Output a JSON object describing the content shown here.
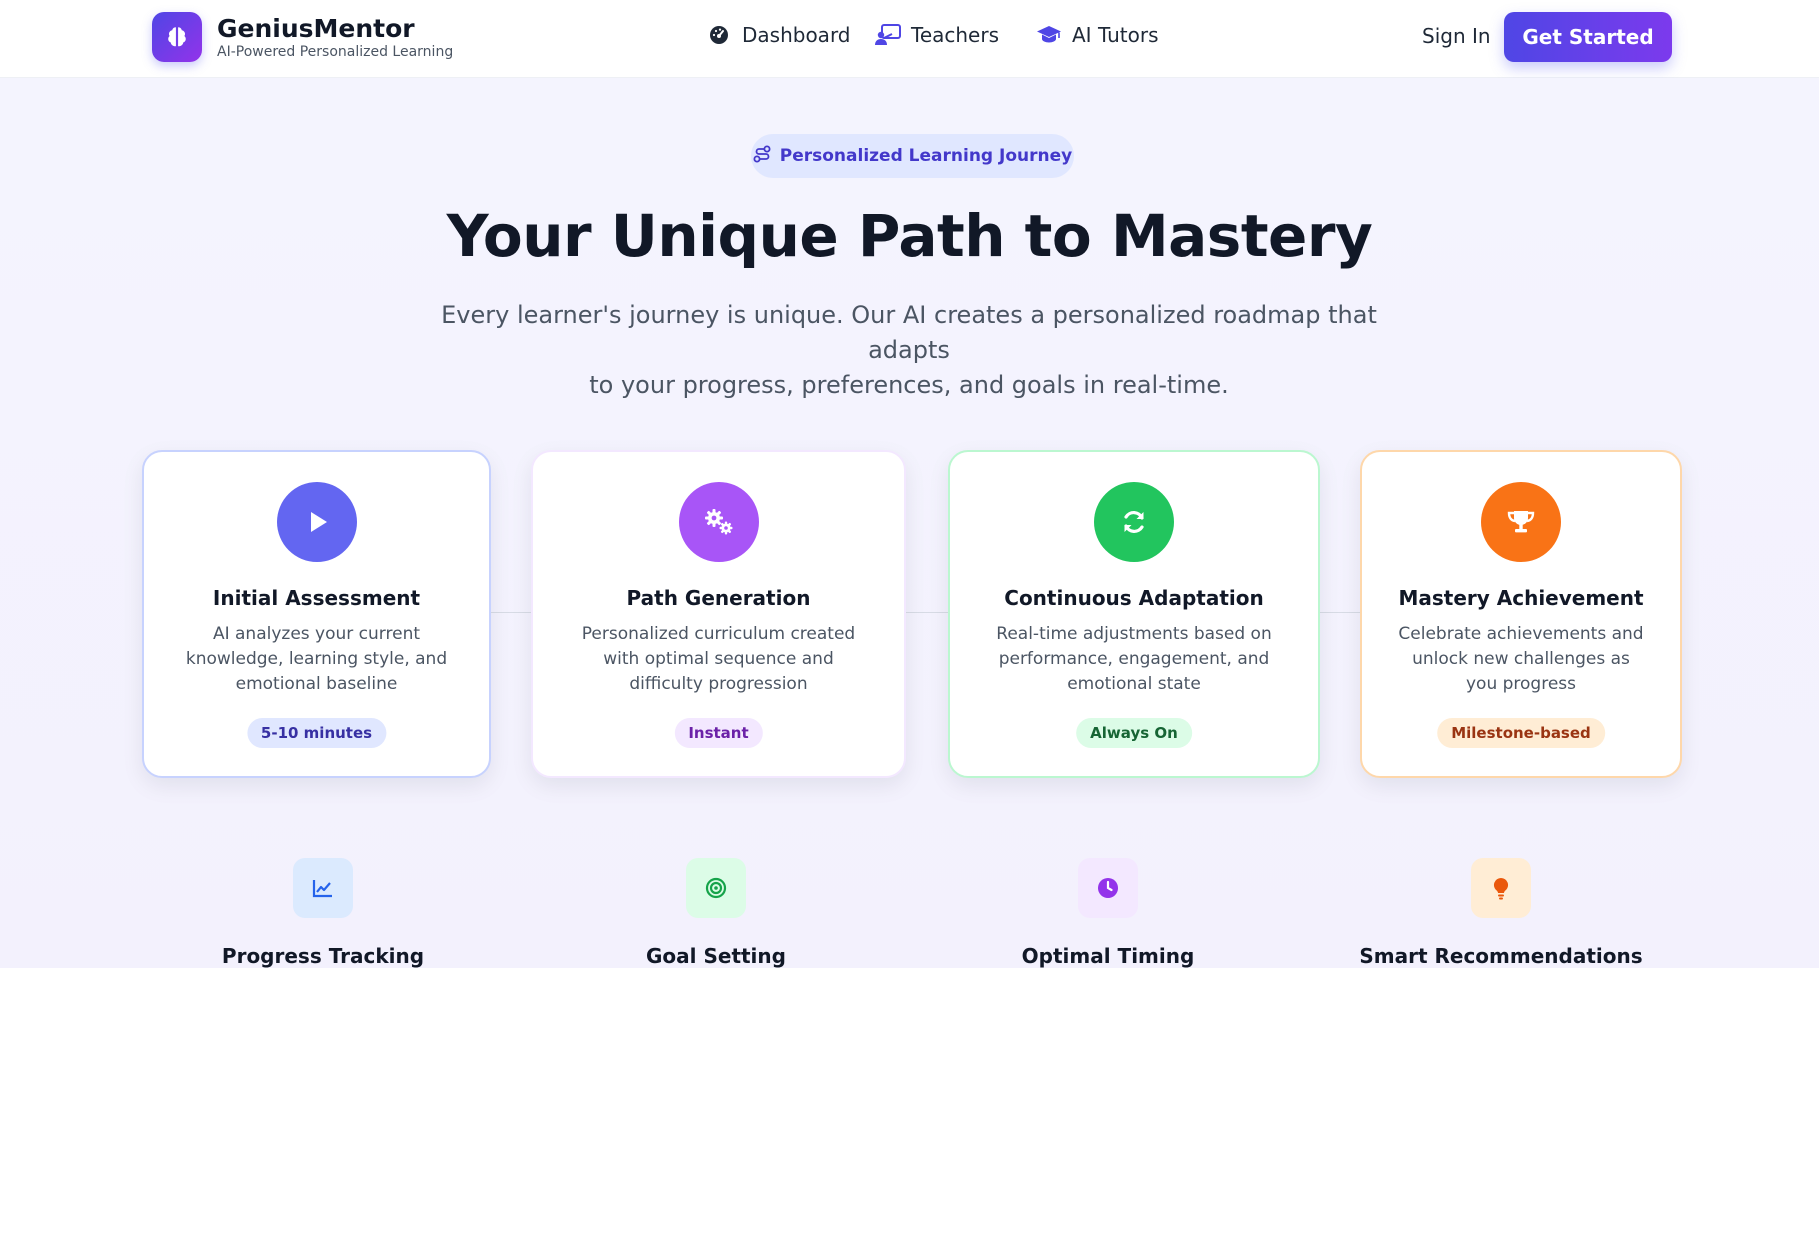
{
  "header": {
    "brand_name": "GeniusMentor",
    "brand_tagline": "AI-Powered Personalized Learning",
    "nav": [
      {
        "label": "Dashboard",
        "icon": "dashboard-gauge-icon"
      },
      {
        "label": "Teachers",
        "icon": "teacher-board-icon"
      },
      {
        "label": "AI Tutors",
        "icon": "graduation-cap-icon"
      }
    ],
    "sign_in": "Sign In",
    "get_started": "Get Started"
  },
  "hero": {
    "pill_label": "Personalized Learning Journey",
    "title": "Your Unique Path to Mastery",
    "subtitle_line1": "Every learner's journey is unique. Our AI creates a personalized roadmap that adapts",
    "subtitle_line2": "to your progress, preferences, and goals in real-time."
  },
  "steps": [
    {
      "title": "Initial Assessment",
      "desc": "AI analyzes your current knowledge, learning style, and emotional baseline",
      "badge": "5-10 minutes",
      "icon": "play-icon",
      "color": "#6366f1"
    },
    {
      "title": "Path Generation",
      "desc": "Personalized curriculum created with optimal sequence and difficulty progression",
      "badge": "Instant",
      "icon": "gears-icon",
      "color": "#a855f7"
    },
    {
      "title": "Continuous Adaptation",
      "desc": "Real-time adjustments based on performance, engagement, and emotional state",
      "badge": "Always On",
      "icon": "refresh-icon",
      "color": "#22c55e"
    },
    {
      "title": "Mastery Achievement",
      "desc": "Celebrate achievements and unlock new challenges as you progress",
      "badge": "Milestone-based",
      "icon": "trophy-icon",
      "color": "#f97316"
    }
  ],
  "features": [
    {
      "label": "Progress Tracking",
      "icon": "line-chart-icon"
    },
    {
      "label": "Goal Setting",
      "icon": "target-icon"
    },
    {
      "label": "Optimal Timing",
      "icon": "clock-icon"
    },
    {
      "label": "Smart Recommendations",
      "icon": "lightbulb-icon"
    }
  ]
}
